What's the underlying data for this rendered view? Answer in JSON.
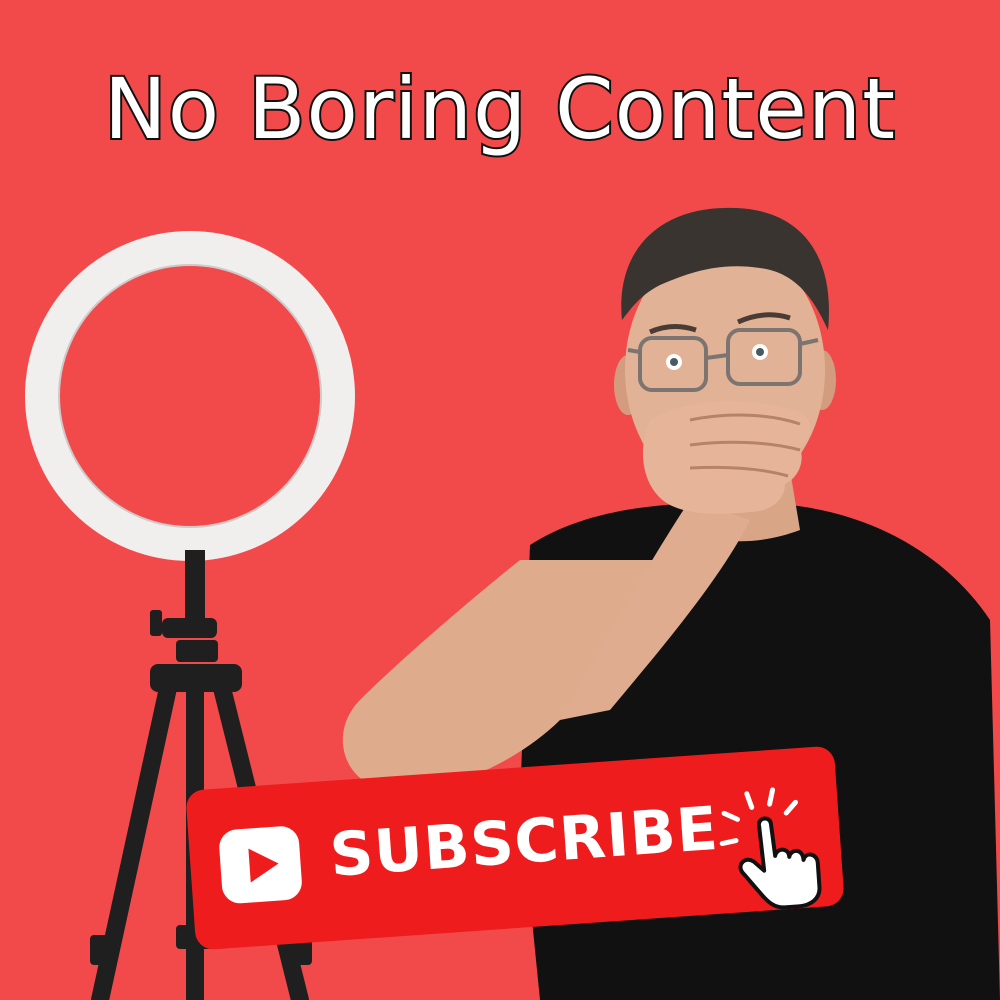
{
  "headline": {
    "text": "No Boring Content"
  },
  "subscribe_button": {
    "label": "SUBSCRIBE",
    "icon": "youtube-play-icon",
    "pointer_icon": "hand-pointer-icon"
  },
  "colors": {
    "background": "#f24a4a",
    "button_red": "#ee1c1c",
    "headline_fill": "#ffffff",
    "headline_outline": "#111111"
  },
  "scene": {
    "ring_light": "ring-light-on-tripod-icon",
    "person": "man-in-glasses-covering-mouth-illustration"
  }
}
